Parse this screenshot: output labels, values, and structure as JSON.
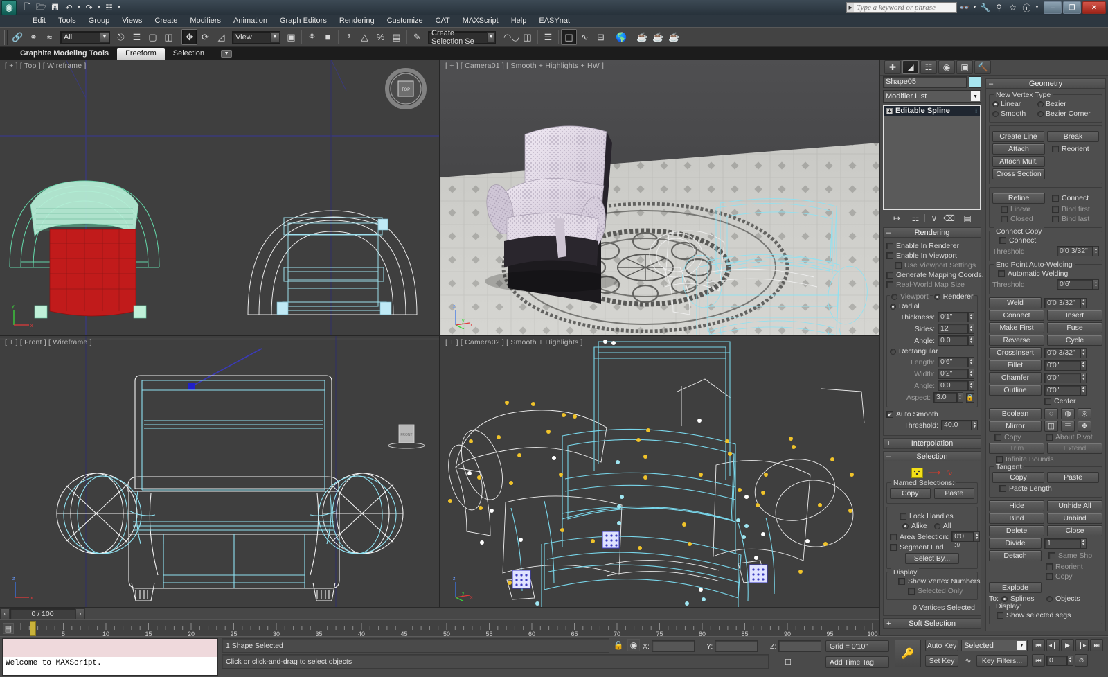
{
  "titlebar": {
    "logo": "max-logo-icon",
    "quick_access": [
      "new-file-icon",
      "open-file-icon",
      "save-file-icon",
      "undo-icon",
      "redo-icon",
      "set-key-filters-icon"
    ],
    "search_placeholder": "Type a keyword or phrase",
    "help_icons": [
      "binoculars-icon",
      "wrench-icon",
      "subscription-icon",
      "favorites-star-icon",
      "help-question-icon"
    ],
    "window_buttons": {
      "minimize": "–",
      "maximize": "❐",
      "close": "✕"
    }
  },
  "menu": [
    "Edit",
    "Tools",
    "Group",
    "Views",
    "Create",
    "Modifiers",
    "Animation",
    "Graph Editors",
    "Rendering",
    "Customize",
    "CAT",
    "MAXScript",
    "Help",
    "EASYnat"
  ],
  "toolbar": {
    "selection_filter": "All",
    "reference_coord": "View",
    "named_selection_set": "Create Selection Se",
    "icons_left": [
      "select-link-icon",
      "unlink-icon",
      "bind-space-warp-icon"
    ],
    "icons_mid": [
      "select-object-icon",
      "select-by-name-icon",
      "rect-selection-region-icon",
      "window-crossing-icon"
    ],
    "icons_move": [
      "select-move-icon",
      "select-rotate-icon",
      "select-scale-icon"
    ],
    "icons_right": [
      "use-pivot-center-icon",
      "select-manipulate-icon",
      "snap-toggle-icon",
      "angle-snap-icon",
      "percent-snap-icon",
      "spinner-snap-icon",
      "edit-named-selection-icon"
    ],
    "icons_far": [
      "mirror-icon",
      "align-icon",
      "layer-manager-icon",
      "curve-editor-icon",
      "schematic-view-icon",
      "material-editor-icon",
      "render-setup-icon",
      "rendered-frame-icon",
      "render-production-icon"
    ]
  },
  "ribbon": {
    "tabs": [
      "Graphite Modeling Tools",
      "Freeform",
      "Selection"
    ],
    "selected_tab": "Freeform",
    "minimize_icon": "chevron-down-icon"
  },
  "viewports": [
    {
      "id": "top-left",
      "label": "[ + ] [ Top ] [ Wireframe ]",
      "active": false,
      "axis": [
        "y",
        "x",
        "z"
      ]
    },
    {
      "id": "top-right",
      "label": "[ + ] [ Camera01 ] [ Smooth + Highlights + HW ]",
      "active": false,
      "axis": [
        "z",
        "y",
        "x"
      ]
    },
    {
      "id": "bottom-left",
      "label": "[ + ] [ Front ] [ Wireframe ]",
      "active": false,
      "axis": [
        "z",
        "y",
        "x"
      ]
    },
    {
      "id": "bottom-right",
      "label": "[ + ] [ Camera02 ] [ Smooth + Highlights ]",
      "active": true,
      "axis": [
        "z",
        "y",
        "x"
      ]
    }
  ],
  "command_panel": {
    "tabs": [
      "create-tab-icon",
      "modify-tab-icon",
      "hierarchy-tab-icon",
      "motion-tab-icon",
      "display-tab-icon",
      "utilities-tab-icon"
    ],
    "selected_tab_index": 1,
    "object_name": "Shape05",
    "object_color": "#a7e4ee",
    "modifier_list_label": "Modifier List",
    "stack": [
      {
        "label": "Editable Spline",
        "expand": "+"
      }
    ],
    "stack_buttons": [
      "pin-stack-icon",
      "show-end-result-icon",
      "make-unique-icon",
      "remove-modifier-icon",
      "configure-sets-icon"
    ],
    "rendering": {
      "title": "Rendering",
      "enable_in_renderer": {
        "label": "Enable In Renderer",
        "checked": false
      },
      "enable_in_viewport": {
        "label": "Enable In Viewport",
        "checked": false
      },
      "use_viewport_settings": {
        "label": "Use Viewport Settings",
        "checked": false
      },
      "generate_mapping_coords": {
        "label": "Generate Mapping Coords.",
        "checked": false
      },
      "real_world_map_size": {
        "label": "Real-World Map Size",
        "checked": false
      },
      "viewport_radio": {
        "label": "Viewport",
        "selected": false
      },
      "renderer_radio": {
        "label": "Renderer",
        "selected": true
      },
      "radial": {
        "label": "Radial",
        "selected": true
      },
      "thickness": {
        "label": "Thickness:",
        "value": "0'1\""
      },
      "sides": {
        "label": "Sides:",
        "value": "12"
      },
      "angle": {
        "label": "Angle:",
        "value": "0.0"
      },
      "rectangular": {
        "label": "Rectangular",
        "selected": false
      },
      "length": {
        "label": "Length:",
        "value": "0'6\""
      },
      "width": {
        "label": "Width:",
        "value": "0'2\""
      },
      "rect_angle": {
        "label": "Angle:",
        "value": "0.0"
      },
      "aspect": {
        "label": "Aspect:",
        "value": "3.0"
      },
      "auto_smooth": {
        "label": "Auto Smooth",
        "checked": true
      },
      "threshold": {
        "label": "Threshold:",
        "value": "40.0"
      }
    },
    "interpolation": {
      "title": "Interpolation",
      "collapsed": true
    },
    "selection": {
      "title": "Selection",
      "sub_object_icons": [
        "vertex-sub-object-icon",
        "segment-sub-object-icon",
        "spline-sub-object-icon"
      ],
      "named_selections_label": "Named Selections:",
      "copy": "Copy",
      "paste": "Paste",
      "lock_handles": {
        "label": "Lock Handles",
        "checked": false
      },
      "alike": {
        "label": "Alike",
        "selected": true
      },
      "all": {
        "label": "All",
        "selected": false
      },
      "area_selection": {
        "label": "Area Selection:",
        "checked": false,
        "value": "0'0 3/"
      },
      "segment_end": {
        "label": "Segment End",
        "checked": false
      },
      "select_by": "Select By...",
      "display_group": "Display",
      "show_vertex_numbers": {
        "label": "Show Vertex Numbers",
        "checked": false
      },
      "selected_only": {
        "label": "Selected Only",
        "checked": false
      },
      "status": "0 Vertices Selected"
    },
    "soft_selection": {
      "title": "Soft Selection",
      "collapsed": true
    },
    "geometry": {
      "title": "Geometry",
      "new_vertex_type": {
        "label": "New Vertex Type",
        "linear": {
          "label": "Linear",
          "selected": true
        },
        "bezier": {
          "label": "Bezier",
          "selected": false
        },
        "smooth": {
          "label": "Smooth",
          "selected": false
        },
        "bezier_corner": {
          "label": "Bezier Corner",
          "selected": false
        }
      },
      "create_line": "Create Line",
      "break": "Break",
      "attach": "Attach",
      "attach_mult": "Attach Mult.",
      "reorient": {
        "label": "Reorient",
        "checked": false
      },
      "cross_section": "Cross Section",
      "refine": "Refine",
      "connect_chk": {
        "label": "Connect",
        "checked": false
      },
      "refine_linear": {
        "label": "Linear",
        "checked": false
      },
      "bind_first": {
        "label": "Bind first",
        "checked": false
      },
      "refine_closed": {
        "label": "Closed",
        "checked": false
      },
      "bind_last": {
        "label": "Bind last",
        "checked": false
      },
      "connect_copy": {
        "label": "Connect Copy",
        "connect": {
          "label": "Connect",
          "checked": false
        },
        "threshold": {
          "label": "Threshold",
          "value": "0'0 3/32\""
        }
      },
      "end_point_auto_welding": {
        "label": "End Point Auto-Welding",
        "automatic_welding": {
          "label": "Automatic Welding",
          "checked": false
        },
        "threshold": {
          "label": "Threshold",
          "value": "0'6\""
        }
      },
      "weld": {
        "label": "Weld",
        "value": "0'0 3/32\""
      },
      "connect": "Connect",
      "insert": "Insert",
      "make_first": "Make First",
      "fuse": "Fuse",
      "reverse": "Reverse",
      "cycle": "Cycle",
      "crossinsert": {
        "label": "CrossInsert",
        "value": "0'0 3/32\""
      },
      "fillet": {
        "label": "Fillet",
        "value": "0'0\""
      },
      "chamfer": {
        "label": "Chamfer",
        "value": "0'0\""
      },
      "outline": {
        "label": "Outline",
        "value": "0'0\""
      },
      "center": {
        "label": "Center",
        "checked": false
      },
      "boolean": "Boolean",
      "boolean_icons": [
        "union-icon",
        "subtract-icon",
        "intersect-icon"
      ],
      "mirror": "Mirror",
      "mirror_icons": [
        "mirror-horizontal-icon",
        "mirror-vertical-icon",
        "mirror-both-icon"
      ],
      "copy_chk": {
        "label": "Copy",
        "checked": false
      },
      "about_pivot": {
        "label": "About Pivot",
        "checked": false
      },
      "trim": "Trim",
      "extend": "Extend",
      "infinite_bounds": {
        "label": "Infinite Bounds",
        "checked": false
      },
      "tangent": {
        "label": "Tangent",
        "copy": "Copy",
        "paste": "Paste",
        "paste_length": {
          "label": "Paste Length",
          "checked": false
        }
      },
      "hide": "Hide",
      "unhide_all": "Unhide All",
      "bind": "Bind",
      "unbind": "Unbind",
      "delete": "Delete",
      "close": "Close",
      "divide": {
        "label": "Divide",
        "value": "1"
      },
      "detach": "Detach",
      "same_shp": {
        "label": "Same Shp",
        "checked": false
      },
      "detach_reorient": {
        "label": "Reorient",
        "checked": false
      },
      "detach_copy": {
        "label": "Copy",
        "checked": false
      },
      "explode": "Explode",
      "to_label": "To:",
      "splines": {
        "label": "Splines",
        "selected": true
      },
      "objects": {
        "label": "Objects",
        "selected": false
      },
      "display_label": "Display:",
      "show_selected_segs": {
        "label": "Show selected segs",
        "checked": false
      }
    }
  },
  "timeline": {
    "frame_display": "0 / 100",
    "prev_frame_icon": "‹",
    "next_frame_icon": "›",
    "key_mode_icon": "track-bar-icon",
    "ruler_ticks": [
      "5",
      "10",
      "15",
      "20",
      "25",
      "30",
      "35",
      "40",
      "45",
      "50",
      "55",
      "60",
      "65",
      "70",
      "75",
      "80",
      "85",
      "90",
      "95",
      "100"
    ],
    "range_start": 0,
    "range_end": 100,
    "current_frame": 0
  },
  "status": {
    "maxscript_listener": "Welcome to MAXScript.",
    "selection_status": "1 Shape Selected",
    "prompt": "Click or click-and-drag to select objects",
    "lock_icon": "lock-selection-icon",
    "absolute_mode_icon": "absolute-relative-transform-icon",
    "x_label": "X:",
    "x_value": "",
    "y_label": "Y:",
    "y_value": "",
    "z_label": "Z:",
    "z_value": "",
    "grid_info": "Grid = 0'10\"",
    "add_time_tag": "Add Time Tag",
    "snaps_icon": "snaps-toggle-icon",
    "key_icon": "key-mode-icon"
  },
  "anim_controls": {
    "auto_key": "Auto Key",
    "set_key": "Set Key",
    "key_filters": "Key Filters...",
    "selected_level": "Selected",
    "curve_icon": "set-key-curve-icon",
    "frame_value": "0",
    "playback": [
      "go-to-start-icon",
      "prev-frame-icon",
      "play-animation-icon",
      "next-frame-icon",
      "go-to-end-icon"
    ],
    "key_nav": [
      "prev-key-icon",
      "next-key-icon"
    ],
    "time_config_icon": "time-configuration-icon",
    "viewport_nav": [
      "pan-icon",
      "orbit-icon",
      "zoom-icon",
      "maximize-viewport-icon",
      "zoom-extents-icon",
      "field-of-view-icon",
      "walkthrough-icon",
      "zoom-region-icon"
    ]
  }
}
